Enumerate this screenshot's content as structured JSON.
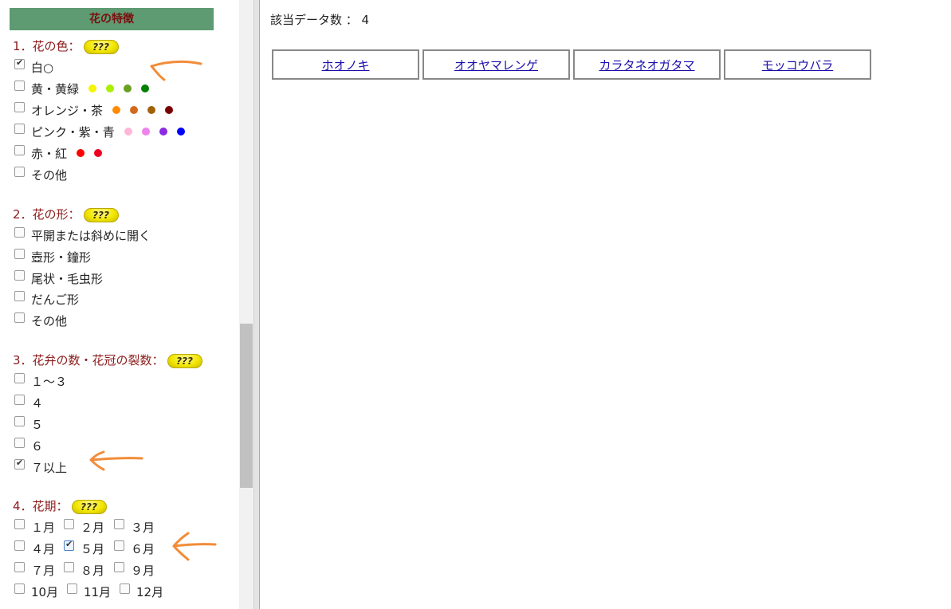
{
  "sidebar": {
    "header": "花の特徴",
    "help_label": "???",
    "sections": [
      {
        "title": "1．花の色：",
        "options": [
          {
            "label": "白○",
            "checked": true,
            "dots": []
          },
          {
            "label": "黄・黄緑",
            "checked": false,
            "dots": [
              "#f5f500",
              "#aaf000",
              "#6aa020",
              "#008000"
            ]
          },
          {
            "label": "オレンジ・茶",
            "checked": false,
            "dots": [
              "#ff8c00",
              "#d2691e",
              "#a0620a",
              "#7a0000"
            ]
          },
          {
            "label": "ピンク・紫・青",
            "checked": false,
            "dots": [
              "#ffb6d9",
              "#ee82ee",
              "#8a2be2",
              "#0000ff"
            ]
          },
          {
            "label": "赤・紅",
            "checked": false,
            "dots": [
              "#ff0000",
              "#ee0022"
            ]
          },
          {
            "label": "その他",
            "checked": false,
            "dots": []
          }
        ]
      },
      {
        "title": "2．花の形：",
        "options": [
          {
            "label": "平開または斜めに開く",
            "checked": false
          },
          {
            "label": "壺形・鐘形",
            "checked": false
          },
          {
            "label": "尾状・毛虫形",
            "checked": false
          },
          {
            "label": "だんご形",
            "checked": false
          },
          {
            "label": "その他",
            "checked": false
          }
        ]
      },
      {
        "title": "3．花弁の数・花冠の裂数：",
        "options": [
          {
            "label": "１～３",
            "checked": false
          },
          {
            "label": "４",
            "checked": false
          },
          {
            "label": "５",
            "checked": false
          },
          {
            "label": "６",
            "checked": false
          },
          {
            "label": "７以上",
            "checked": true
          }
        ]
      },
      {
        "title": "4．花期：",
        "months": [
          {
            "label": "１月",
            "checked": false
          },
          {
            "label": "２月",
            "checked": false
          },
          {
            "label": "３月",
            "checked": false
          },
          {
            "label": "４月",
            "checked": false
          },
          {
            "label": "５月",
            "checked": true
          },
          {
            "label": "６月",
            "checked": false
          },
          {
            "label": "７月",
            "checked": false
          },
          {
            "label": "８月",
            "checked": false
          },
          {
            "label": "９月",
            "checked": false
          },
          {
            "label": "10月",
            "checked": false
          },
          {
            "label": "11月",
            "checked": false
          },
          {
            "label": "12月",
            "checked": false
          }
        ]
      }
    ]
  },
  "main": {
    "result_count": "該当データ数 ： 4",
    "results": [
      "ホオノキ",
      "オオヤマレンゲ",
      "カラタネオガタマ",
      "モッコウバラ"
    ]
  },
  "colors": {
    "header_bg": "#5e9a72",
    "header_text": "#7a0f0f",
    "section_title": "#8b1a1a",
    "annotation_arrow": "#f28c38",
    "link": "#1a0dab"
  }
}
